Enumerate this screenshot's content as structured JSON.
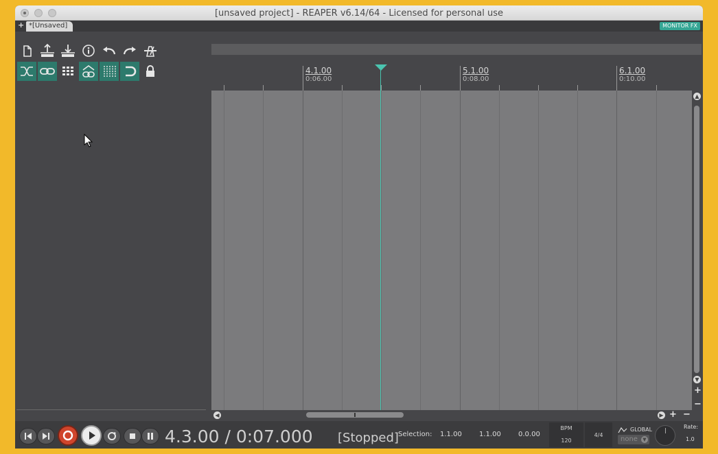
{
  "window": {
    "title": "[unsaved project] - REAPER v6.14/64 - Licensed for personal use"
  },
  "tabs": {
    "add_label": "+",
    "project_tab": "*[Unsaved]",
    "monitor_fx": "MONITOR FX"
  },
  "toolbar": {
    "row1": [
      "new-project-icon",
      "save-project-icon",
      "open-project-icon",
      "project-settings-icon",
      "undo-icon",
      "redo-icon",
      "metronome-icon"
    ],
    "row2": [
      "ripple-edit-icon",
      "grouping-icon",
      "grid-icon",
      "item-grouping-icon",
      "snap-grid-icon",
      "snap-icon",
      "lock-icon"
    ]
  },
  "ruler": {
    "markers": [
      {
        "bar": "4.1.00",
        "time": "0:06.00"
      },
      {
        "bar": "5.1.00",
        "time": "0:08.00"
      },
      {
        "bar": "6.1.00",
        "time": "0:10.00"
      }
    ]
  },
  "transport": {
    "position": "4.3.00 / 0:07.000",
    "state": "[Stopped]",
    "selection_label": "Selection:",
    "selection_start": "1.1.00",
    "selection_end": "1.1.00",
    "selection_length": "0.0.00",
    "bpm_label": "BPM",
    "bpm_value": "120",
    "time_signature": "4/4",
    "global_label": "GLOBAL",
    "envelope_mode": "none",
    "rate_label": "Rate:",
    "rate_value": "1.0"
  },
  "colors": {
    "accent": "#35a695",
    "playhead": "#49c4ae",
    "record": "#d0452c",
    "background": "#464649"
  }
}
